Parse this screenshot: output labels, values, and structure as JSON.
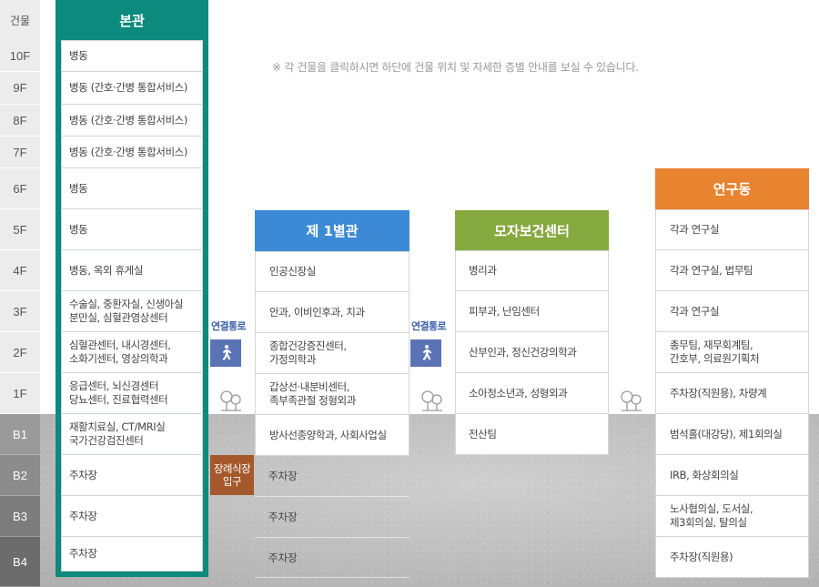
{
  "floor_header": "건물",
  "floors": [
    "10F",
    "9F",
    "8F",
    "7F",
    "6F",
    "5F",
    "4F",
    "3F",
    "2F",
    "1F",
    "B1",
    "B2",
    "B3",
    "B4"
  ],
  "notice": "※ 각 건물을 클릭하시면 하단에 건물 위치 및 자세한 층별 안내를 보실 수 있습니다.",
  "buildings": {
    "main": {
      "title": "본관",
      "color": "#0b8a7d",
      "rows": [
        "병동",
        "병동 (간호·간병 통합서비스)",
        "병동 (간호·간병 통합서비스)",
        "병동 (간호·간병 통합서비스)",
        "병동",
        "병동",
        "병동, 옥외 휴게실",
        "수술실, 중환자실, 신생아실\n분만실, 심혈관영상센터",
        "심혈관센터, 내시경센터,\n소화기센터, 영상의학과",
        "응급센터, 뇌신경센터\n당뇨센터, 진료협력센터",
        "재활치료실, CT/MRI실\n국가건강검진센터",
        "주차장",
        "주차장",
        "주차장"
      ]
    },
    "annex1": {
      "title": "제 1별관",
      "color": "#3c8ad6",
      "rows": [
        "인공신장실",
        "안과, 이비인후과, 치과",
        "종합건강증진센터,\n가정의학과",
        "갑상선·내분비센터,\n족부족관절 정형외과",
        "방사선종양학과, 사회사업실"
      ],
      "parking": [
        "주차장",
        "주차장",
        "주차장"
      ]
    },
    "maternal": {
      "title": "모자보건센터",
      "color": "#86a93f",
      "rows": [
        "병리과",
        "피부과, 난임센터",
        "산부인과, 정신건강의학과",
        "소아청소년과, 성형외과",
        "전산팀"
      ]
    },
    "research": {
      "title": "연구동",
      "color": "#e8832f",
      "rows": [
        "각과 연구실",
        "각과 연구실, 법무팀",
        "각과 연구실",
        "총무팀, 재무회계팀,\n간호부, 의료원기획처",
        "주차장(직원용), 차량계",
        "범석홀(대강당), 제1회의실",
        "IRB, 화상회의실",
        "노사협의실, 도서실,\n제3회의실, 탈의실",
        "주차장(직원용)"
      ]
    }
  },
  "connector_label": "연결통로",
  "funeral_label": "장례식장\n입구",
  "icons": {
    "connector": "walking-person-icon",
    "tree": "tree-icon"
  }
}
